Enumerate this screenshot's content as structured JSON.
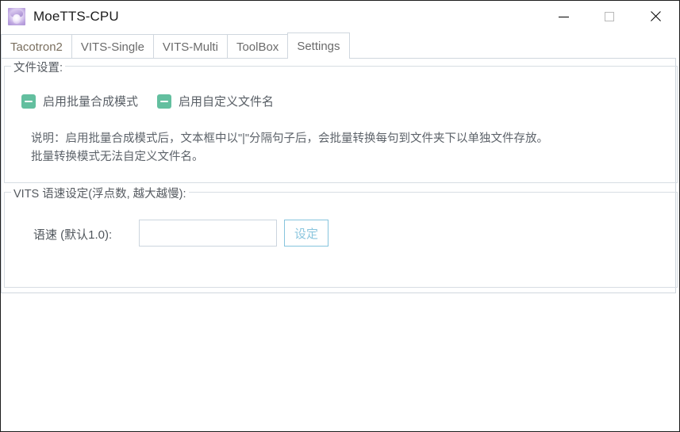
{
  "window": {
    "title": "MoeTTS-CPU",
    "icon": "app-icon",
    "controls": {
      "minimize": "minimize-icon",
      "maximize": "maximize-icon",
      "close": "close-icon"
    }
  },
  "tabs": [
    {
      "label": "Tacotron2",
      "active": false
    },
    {
      "label": "VITS-Single",
      "active": false
    },
    {
      "label": "VITS-Multi",
      "active": false
    },
    {
      "label": "ToolBox",
      "active": false
    },
    {
      "label": "Settings",
      "active": true
    }
  ],
  "file_settings": {
    "group_label": "文件设置:",
    "checkboxes": [
      {
        "label": "启用批量合成模式",
        "state": "indeterminate"
      },
      {
        "label": "启用自定义文件名",
        "state": "indeterminate"
      }
    ],
    "description_line1": "说明：启用批量合成模式后，文本框中以\"|\"分隔句子后，会批量转换每句到文件夹下以单独文件存放。",
    "description_line2": "批量转换模式无法自定义文件名。"
  },
  "speed_settings": {
    "group_label": "VITS 语速设定(浮点数, 越大越慢):",
    "field_label": "语速 (默认1.0):",
    "input_value": "",
    "input_placeholder": "",
    "button_label": "设定"
  },
  "colors": {
    "checkbox_fill": "#63bf9f",
    "button_border": "#86c4dd",
    "button_text": "#8bc6de",
    "group_border": "#d7dde3",
    "tab_border": "#d0d7de"
  }
}
